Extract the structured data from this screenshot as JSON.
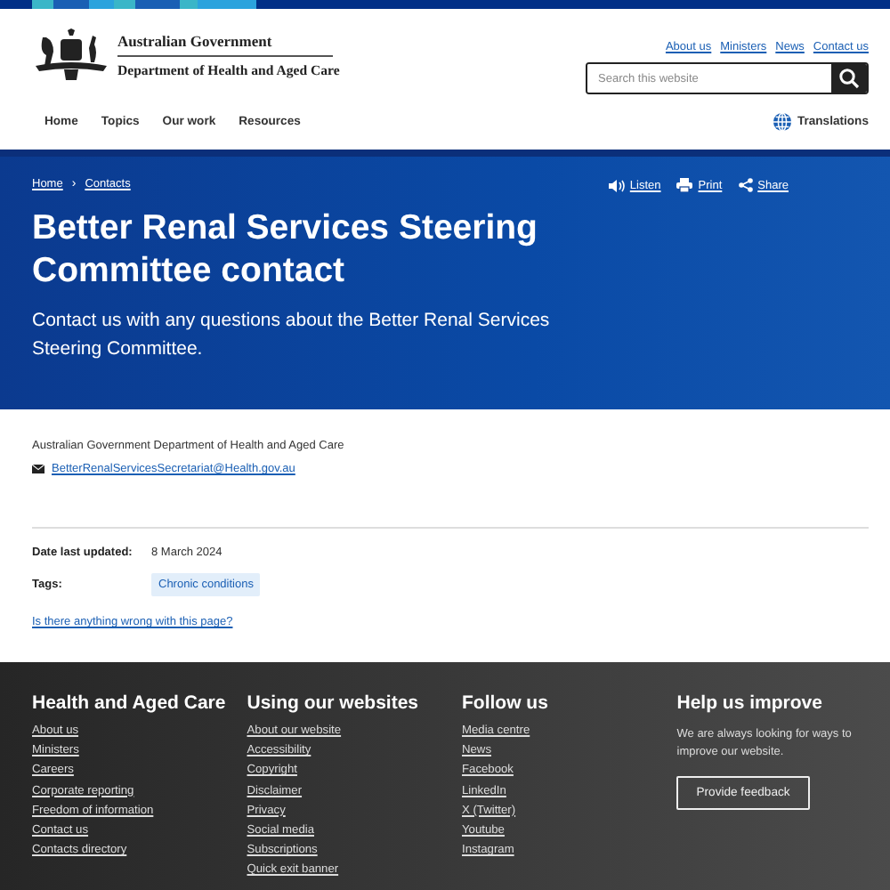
{
  "header": {
    "logo": {
      "line_1": "Australian Government",
      "line_2": "Department of Health and Aged Care"
    },
    "utility_links": [
      "About us",
      "Ministers",
      "News",
      "Contact us"
    ],
    "search": {
      "placeholder": "Search this website"
    },
    "nav": [
      "Home",
      "Topics",
      "Our work",
      "Resources"
    ],
    "translations": "Translations"
  },
  "hero": {
    "breadcrumbs": [
      "Home",
      "Contacts"
    ],
    "breadcrumb_separator": "›",
    "actions": [
      {
        "kind": "listen",
        "label": "Listen"
      },
      {
        "kind": "print",
        "label": "Print"
      },
      {
        "kind": "share",
        "label": "Share"
      }
    ],
    "title": "Better Renal Services Steering Committee contact",
    "intro": "Contact us with any questions about the Better Renal Services Steering Committee."
  },
  "contact": {
    "organisation": "Australian Government Department of Health and Aged Care",
    "email": "BetterRenalServicesSecretariat@Health.gov.au"
  },
  "meta": {
    "date_label": "Date last updated:",
    "date": "8 March 2024",
    "tags_label": "Tags:",
    "tags": [
      "Chronic conditions"
    ]
  },
  "feedback_link": "Is there anything wrong with this page?",
  "footer": {
    "columns": [
      {
        "heading": "Health and Aged Care",
        "links": [
          "About us",
          "Ministers",
          "Careers",
          "Corporate reporting",
          "Freedom of information",
          "Contact us",
          "Contacts directory"
        ]
      },
      {
        "heading": "Using our websites",
        "links": [
          "About our website",
          "Accessibility",
          "Copyright",
          "Disclaimer",
          "Privacy",
          "Social media",
          "Subscriptions",
          "Quick exit banner"
        ]
      },
      {
        "heading": "Follow us",
        "links": [
          "Media centre",
          "News",
          "Facebook",
          "LinkedIn",
          "X (Twitter)",
          "Youtube",
          "Instagram"
        ]
      }
    ],
    "improve": {
      "heading": "Help us improve",
      "text": "We are always looking for ways to improve our website.",
      "button": "Provide feedback"
    }
  }
}
